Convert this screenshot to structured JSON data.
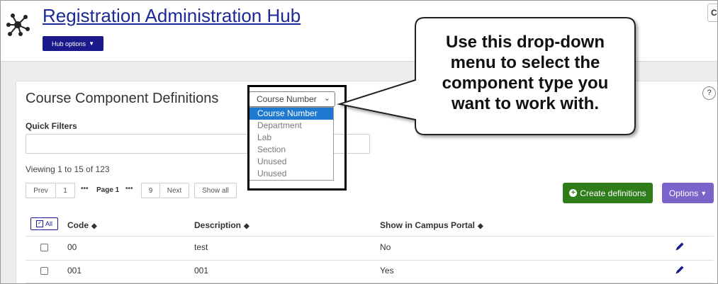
{
  "header": {
    "title": "Registration Administration Hub",
    "hub_options_label": "Hub options",
    "corner_glyph": "C"
  },
  "card": {
    "title": "Course Component Definitions",
    "help_label": "?"
  },
  "component_select": {
    "selected": "Course Number",
    "options": [
      "Course Number",
      "Department",
      "Lab",
      "Section",
      "Unused",
      "Unused"
    ]
  },
  "filters": {
    "quick_filters_label": "Quick Filters",
    "quick_filters_value": ""
  },
  "listing": {
    "viewing_text": "Viewing 1 to 15 of 123"
  },
  "pagination": {
    "prev": "Prev",
    "first": "1",
    "ellipsis": "•••",
    "current": "Page 1",
    "last": "9",
    "next": "Next",
    "show_all": "Show all"
  },
  "actions": {
    "create_label": "Create definitions",
    "options_label": "Options"
  },
  "table": {
    "select_all_label": "All",
    "columns": [
      "Code",
      "Description",
      "Show in Campus Portal"
    ],
    "rows": [
      {
        "code": "00",
        "description": "test",
        "portal": "No"
      },
      {
        "code": "001",
        "description": "001",
        "portal": "Yes"
      }
    ]
  },
  "callout": {
    "lines": [
      "Use this drop-down",
      "menu to select the",
      "component type you",
      "want to work with."
    ]
  },
  "colors": {
    "title_link": "#1a2a96",
    "hub_button": "#1a1a8c",
    "create_button": "#2f7d1a",
    "options_button": "#7a63c9",
    "dropdown_selected": "#1e7ad0",
    "edit_icon": "#1a1a8c"
  },
  "icons": {
    "logo": "network-hub-icon",
    "help": "help-circle-icon",
    "chevron": "chevron-down-icon",
    "create": "plus-circle-icon",
    "sort": "sort-icon",
    "edit": "pencil-icon"
  }
}
